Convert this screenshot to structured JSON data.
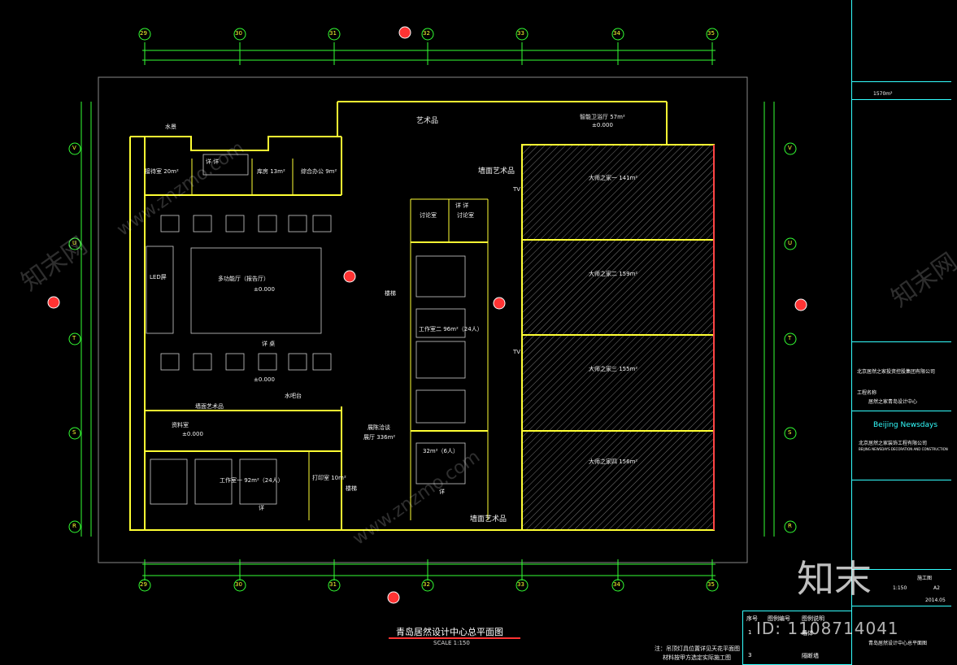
{
  "drawing": {
    "title": "青岛居然设计中心总平面图",
    "scale": "SCALE 1:150",
    "note_line1": "注：吊顶灯具位置详见天花平面图",
    "note_line2": "材料按甲方选定实际施工图"
  },
  "grid": {
    "columns_top": [
      "29",
      "30",
      "31",
      "32",
      "33",
      "34",
      "35"
    ],
    "columns_bottom": [
      "29",
      "30",
      "31",
      "32",
      "33",
      "34",
      "35"
    ],
    "rows_left": [
      "V",
      "U",
      "T",
      "S",
      "R"
    ],
    "rows_right": [
      "V",
      "U",
      "T",
      "S",
      "R"
    ]
  },
  "rooms": {
    "water_feature": "水景",
    "reception": "接待室 20m²",
    "warehouse": "库房 13m²",
    "office": "综合办公 9m²",
    "art_top": "艺术品",
    "smart_bath": "智能卫浴厅 57m²",
    "smart_bath_level": "±0.000",
    "lecture": "多功能厅（报告厅）",
    "lecture_level": "±0.000",
    "led": "LED屏",
    "seat_label_mid": "详 桌",
    "lecture_level2": "±0.000",
    "water_bar": "水吧台",
    "library": "资料室",
    "library_level": "±0.000",
    "studio_left": "工作室一 92m²（24人）",
    "print_room": "打印室 10m²",
    "studio_mid": "工作室二 96m²（24人）",
    "studio_small": "32m²（6人）",
    "discuss": "讨论室",
    "discuss2": "讨论室",
    "lobby": "展厅 336m²",
    "lobby_sub": "展陈洽谈",
    "art_wall1": "墙面艺术品",
    "art_wall2": "墙面艺术品",
    "art_wall3": "墙面艺术品",
    "stair": "楼梯",
    "stair2": "楼梯",
    "brand_hall1": "大师之家一 141m²",
    "brand_hall2": "大师之家二 159m²",
    "brand_hall3": "大师之家三 155m²",
    "brand_hall4": "大师之家四 156m²",
    "plate": "详 详",
    "detail": "详 详",
    "detail2": "详",
    "detail3": "详",
    "tv": "TV",
    "tv2": "TV",
    "art_mid": "艺术品"
  },
  "title_block": {
    "company_cn": "北京居然之家投资控股集团有限公司",
    "project_label": "工程名称",
    "project": "居然之家青岛设计中心",
    "brand_en": "Beijing Newsdays",
    "designer_cn": "北京居然之家装饰工程有限公司",
    "designer_en": "BEIJING NEWSDAYS DECORATION AND CONSTRUCTION",
    "area": "1570m²",
    "stage": "施工图",
    "scale_val": "1:150",
    "size": "A2",
    "date": "2014.05",
    "drawing_name": "青岛居然设计中心总平面图"
  },
  "legend": {
    "col_no": "序号",
    "col_code": "图例编号",
    "col_name": "图例说明",
    "row1_no": "1",
    "row2_no": "3",
    "row1_name": "墙体",
    "row2_name": "隔断墙"
  },
  "watermark": {
    "brand": "知末网",
    "url": "www.znzmo.com",
    "logo": "知末",
    "id": "ID: 1108714041"
  }
}
